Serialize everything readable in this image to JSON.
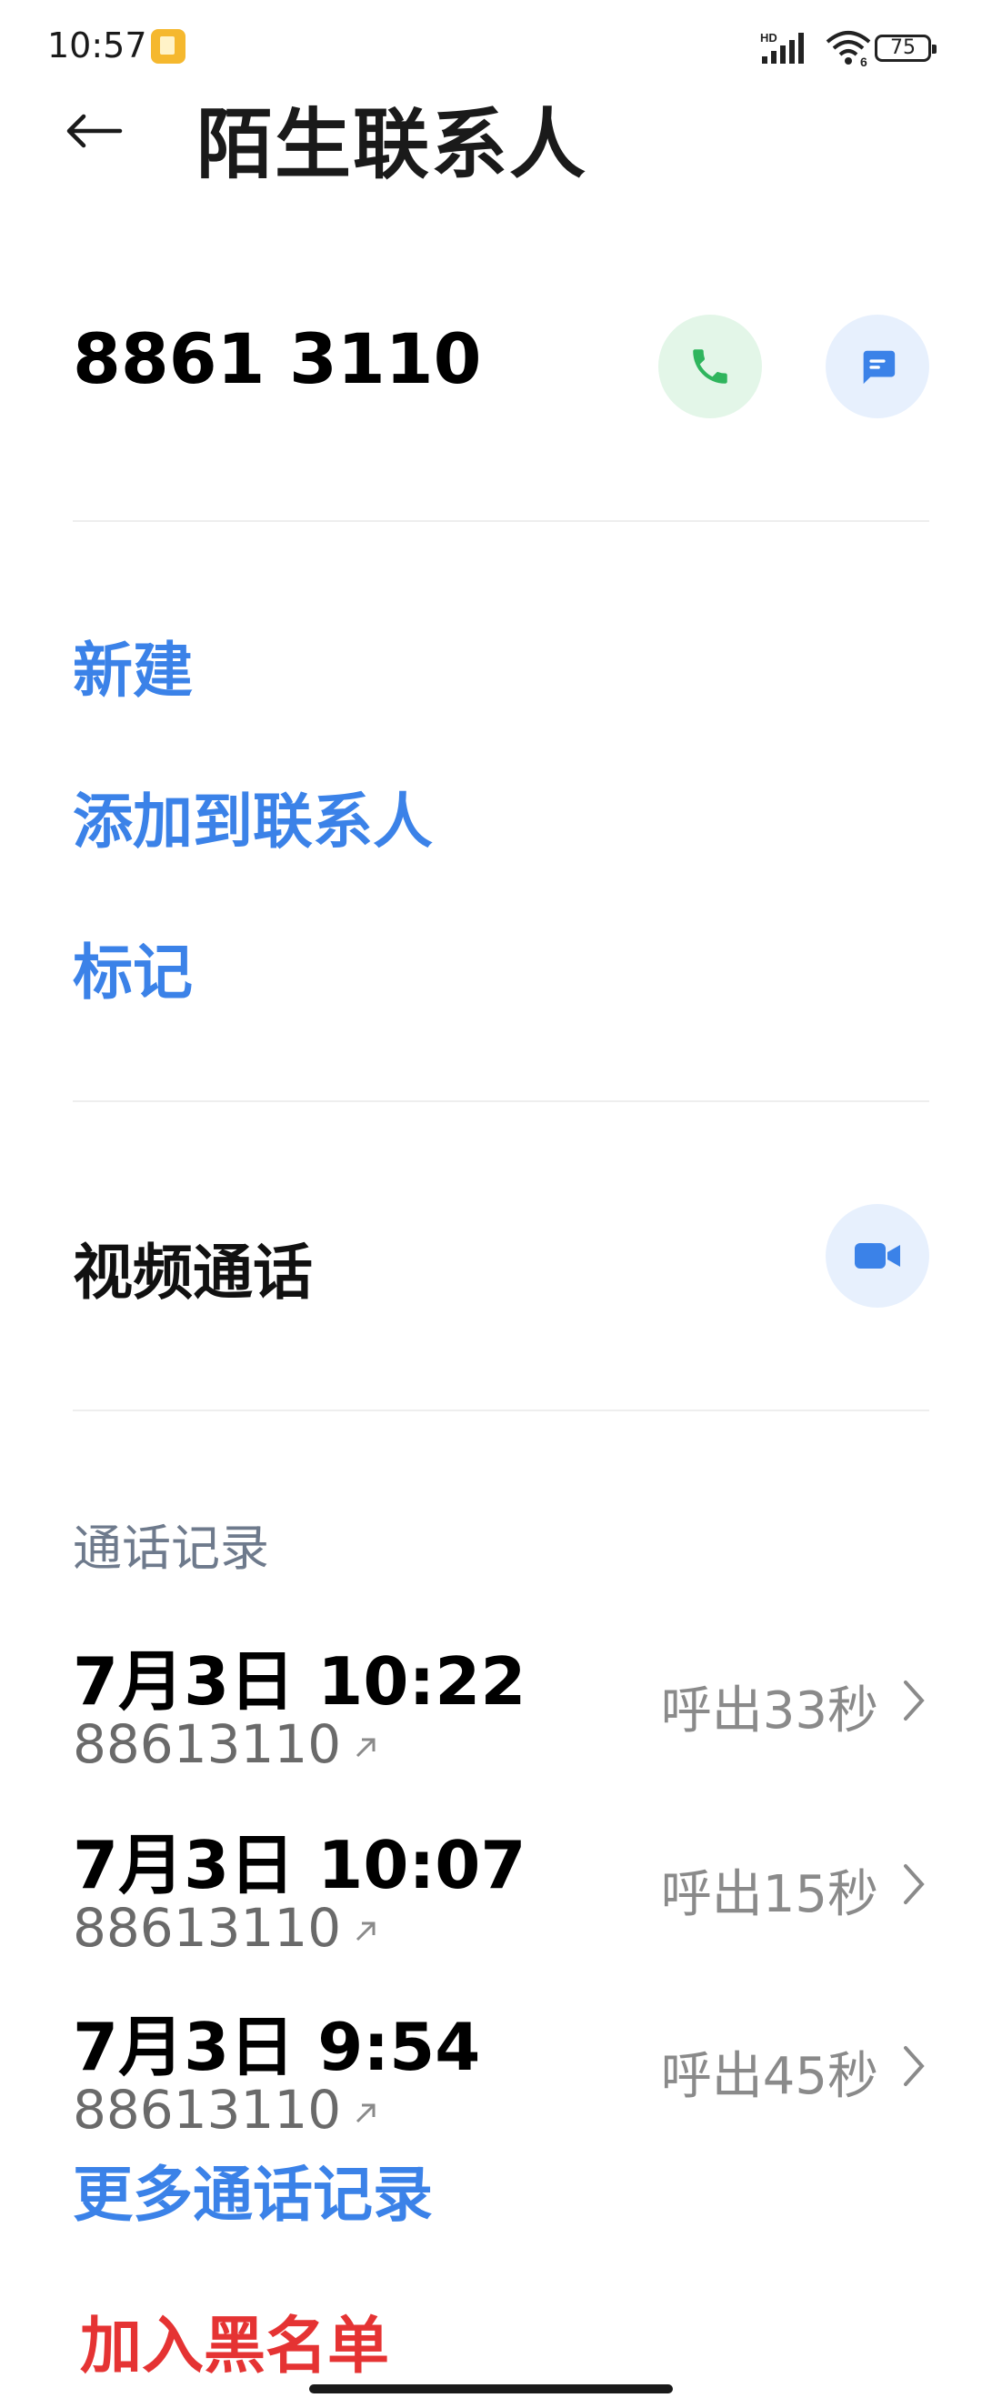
{
  "status_bar": {
    "time": "10:57",
    "battery": "75",
    "network_label": "HD",
    "notification_icon": "app-notification-icon"
  },
  "header": {
    "title": "陌生联系人",
    "back_icon": "back-arrow-icon"
  },
  "contact": {
    "number": "8861 3110",
    "call_icon": "phone-icon",
    "message_icon": "message-icon",
    "call_color": "#2fb55d",
    "message_color": "#3b82e8"
  },
  "actions": {
    "new": "新建",
    "add_to_contacts": "添加到联系人",
    "mark": "标记"
  },
  "video_call": {
    "label": "视频通话",
    "icon": "video-camera-icon"
  },
  "call_log": {
    "header": "通话记录",
    "entries": [
      {
        "datetime": "7月3日 10:22",
        "number": "88613110",
        "summary": "呼出33秒"
      },
      {
        "datetime": "7月3日 10:07",
        "number": "88613110",
        "summary": "呼出15秒"
      },
      {
        "datetime": "7月3日 9:54",
        "number": "88613110",
        "summary": "呼出45秒"
      }
    ],
    "more_link": "更多通话记录"
  },
  "blacklist": {
    "label": "加入黑名单",
    "color": "#e53333"
  },
  "colors": {
    "accent": "#3b82e8",
    "danger": "#e53333",
    "secondary_text": "#8a8a8a",
    "section_header": "#6e7a8c"
  }
}
